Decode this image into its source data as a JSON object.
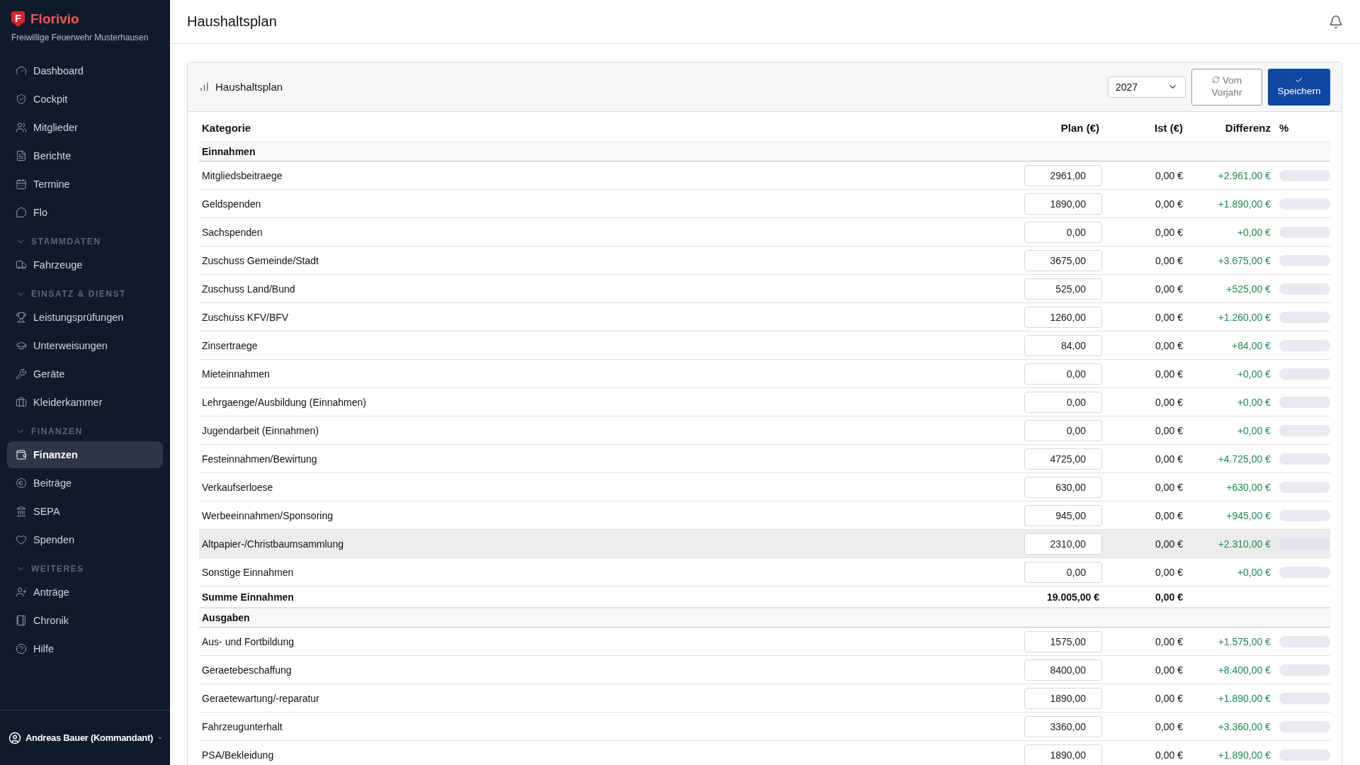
{
  "sidebar": {
    "logo_letter": "F",
    "brand": "Florivio",
    "org": "Freiwillige Feuerwehr Musterhausen",
    "groups": [
      {
        "items": [
          {
            "label": "Dashboard",
            "selected": false
          },
          {
            "label": "Cockpit",
            "selected": false
          },
          {
            "label": "Mitglieder",
            "selected": false
          },
          {
            "label": "Berichte",
            "selected": false
          },
          {
            "label": "Termine",
            "selected": false
          },
          {
            "label": "Flo",
            "selected": false
          }
        ]
      },
      {
        "heading": "STAMMDATEN",
        "expanded": true,
        "items": [
          {
            "label": "Fahrzeuge",
            "selected": false
          }
        ]
      },
      {
        "heading": "EINSATZ & DIENST",
        "expanded": true,
        "items": [
          {
            "label": "Leistungsprüfungen",
            "selected": false
          },
          {
            "label": "Unterweisungen",
            "selected": false
          },
          {
            "label": "Geräte",
            "selected": false
          },
          {
            "label": "Kleiderkammer",
            "selected": false
          }
        ]
      },
      {
        "heading": "FINANZEN",
        "expanded": true,
        "items": [
          {
            "label": "Finanzen",
            "selected": true
          },
          {
            "label": "Beiträge",
            "selected": false
          },
          {
            "label": "SEPA",
            "selected": false
          },
          {
            "label": "Spenden",
            "selected": false
          }
        ]
      },
      {
        "heading": "WEITERES",
        "expanded": true,
        "items": [
          {
            "label": "Anträge",
            "selected": false
          },
          {
            "label": "Chronik",
            "selected": false
          },
          {
            "label": "Hilfe",
            "selected": false
          }
        ]
      }
    ],
    "user": "Andreas Bauer (Kommandant)"
  },
  "page_title": "Haushaltsplan",
  "card": {
    "title": "Haushaltsplan",
    "year": "2027",
    "buttons": [
      {
        "label": "Vom Vorjahr",
        "kind": "secondary"
      },
      {
        "label": "Speichern",
        "kind": "primary"
      }
    ]
  },
  "table": {
    "columns": [
      "Kategorie",
      "Plan (€)",
      "Ist (€)",
      "Differenz",
      "%"
    ],
    "rows": [
      {
        "kind": "section",
        "label": "Einnahmen"
      },
      {
        "kind": "item",
        "label": "Mitgliedsbeitraege",
        "plan": "2961,00",
        "ist": "0,00 €",
        "diff": "+2.961,00 €",
        "level": 0,
        "highlighted": false
      },
      {
        "kind": "item",
        "label": "Geldspenden",
        "plan": "1890,00",
        "ist": "0,00 €",
        "diff": "+1.890,00 €",
        "level": 0,
        "highlighted": false
      },
      {
        "kind": "item",
        "label": "Sachspenden",
        "plan": "0,00",
        "ist": "0,00 €",
        "diff": "+0,00 €",
        "level": 0,
        "highlighted": false
      },
      {
        "kind": "item",
        "label": "Zuschuss Gemeinde/Stadt",
        "plan": "3675,00",
        "ist": "0,00 €",
        "diff": "+3.675,00 €",
        "level": 0,
        "highlighted": false
      },
      {
        "kind": "item",
        "label": "Zuschuss Land/Bund",
        "plan": "525,00",
        "ist": "0,00 €",
        "diff": "+525,00 €",
        "level": 0,
        "highlighted": false
      },
      {
        "kind": "item",
        "label": "Zuschuss KFV/BFV",
        "plan": "1260,00",
        "ist": "0,00 €",
        "diff": "+1.260,00 €",
        "level": 0,
        "highlighted": false
      },
      {
        "kind": "item",
        "label": "Zinsertraege",
        "plan": "84,00",
        "ist": "0,00 €",
        "diff": "+84,00 €",
        "level": 0,
        "highlighted": false
      },
      {
        "kind": "item",
        "label": "Mieteinnahmen",
        "plan": "0,00",
        "ist": "0,00 €",
        "diff": "+0,00 €",
        "level": 0,
        "highlighted": false
      },
      {
        "kind": "item",
        "label": "Lehrgaenge/Ausbildung (Einnahmen)",
        "plan": "0,00",
        "ist": "0,00 €",
        "diff": "+0,00 €",
        "level": 0,
        "highlighted": false
      },
      {
        "kind": "item",
        "label": "Jugendarbeit (Einnahmen)",
        "plan": "0,00",
        "ist": "0,00 €",
        "diff": "+0,00 €",
        "level": 0,
        "highlighted": false
      },
      {
        "kind": "item",
        "label": "Festeinnahmen/Bewirtung",
        "plan": "4725,00",
        "ist": "0,00 €",
        "diff": "+4.725,00 €",
        "level": 0,
        "highlighted": false
      },
      {
        "kind": "item",
        "label": "Verkaufserloese",
        "plan": "630,00",
        "ist": "0,00 €",
        "diff": "+630,00 €",
        "level": 0,
        "highlighted": false
      },
      {
        "kind": "item",
        "label": "Werbeeinnahmen/Sponsoring",
        "plan": "945,00",
        "ist": "0,00 €",
        "diff": "+945,00 €",
        "level": 0,
        "highlighted": false
      },
      {
        "kind": "item",
        "label": "Altpapier-/Christbaumsammlung",
        "plan": "2310,00",
        "ist": "0,00 €",
        "diff": "+2.310,00 €",
        "level": 0,
        "highlighted": true
      },
      {
        "kind": "item",
        "label": "Sonstige Einnahmen",
        "plan": "0,00",
        "ist": "0,00 €",
        "diff": "+0,00 €",
        "level": 0,
        "highlighted": false
      },
      {
        "kind": "sum",
        "label": "Summe Einnahmen",
        "plan": "19.005,00 €",
        "ist": "0,00 €"
      },
      {
        "kind": "section",
        "label": "Ausgaben"
      },
      {
        "kind": "item",
        "label": "Aus- und Fortbildung",
        "plan": "1575,00",
        "ist": "0,00 €",
        "diff": "+1.575,00 €",
        "level": 0,
        "highlighted": false
      },
      {
        "kind": "item",
        "label": "Geraetebeschaffung",
        "plan": "8400,00",
        "ist": "0,00 €",
        "diff": "+8.400,00 €",
        "level": 0,
        "highlighted": false
      },
      {
        "kind": "item",
        "label": "Geraetewartung/-reparatur",
        "plan": "1890,00",
        "ist": "0,00 €",
        "diff": "+1.890,00 €",
        "level": 0,
        "highlighted": false
      },
      {
        "kind": "item",
        "label": "Fahrzeugunterhalt",
        "plan": "3360,00",
        "ist": "0,00 €",
        "diff": "+3.360,00 €",
        "level": 0,
        "highlighted": false
      },
      {
        "kind": "item",
        "label": "PSA/Bekleidung",
        "plan": "1890,00",
        "ist": "0,00 €",
        "diff": "+1.890,00 €",
        "level": 0,
        "highlighted": false
      }
    ]
  }
}
